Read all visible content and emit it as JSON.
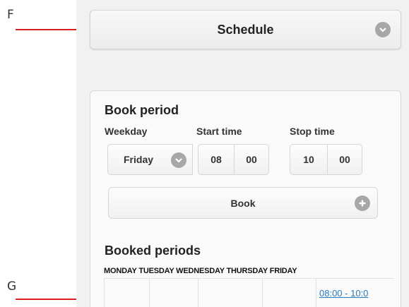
{
  "annotations": {
    "f_label": "F",
    "g_label": "G"
  },
  "schedule": {
    "label": "Schedule",
    "icon": "chevron-down-icon"
  },
  "book_period": {
    "heading": "Book period",
    "weekday_label": "Weekday",
    "start_label": "Start time",
    "stop_label": "Stop time",
    "weekday_value": "Friday",
    "start_hour": "08",
    "start_min": "00",
    "stop_hour": "10",
    "stop_min": "00",
    "book_label": "Book",
    "book_icon": "plus-icon"
  },
  "booked_periods": {
    "heading": "Booked periods",
    "days": [
      "MONDAY",
      "TUESDAY",
      "WEDNESDAY",
      "THURSDAY",
      "FRIDAY"
    ],
    "friday_entry": "08:00 - 10:0"
  },
  "colors": {
    "arrow": "#d81e1e",
    "link": "#2a7ac0",
    "icon_gray": "#a7a7a7"
  }
}
